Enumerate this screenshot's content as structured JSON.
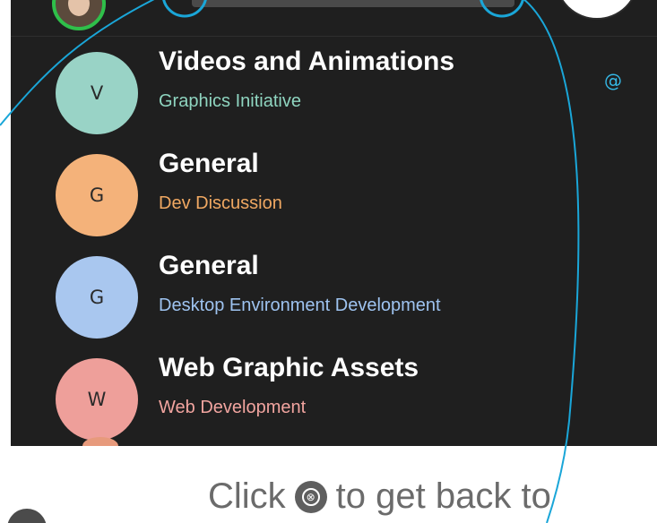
{
  "colors": {
    "app_background": "#1f1f1f",
    "callout_line": "#1aa6d8",
    "presence_ring": "#2fbf4a",
    "mention": "#35b8e6"
  },
  "spaces": [
    {
      "initial": "V",
      "title": "Videos and Animations",
      "team": "Graphics Initiative",
      "avatar_color": "#99d3c6",
      "team_color": "#8fd5c0",
      "mention_icon": "@"
    },
    {
      "initial": "G",
      "title": "General",
      "team": "Dev Discussion",
      "avatar_color": "#f4b27a",
      "team_color": "#f0a862"
    },
    {
      "initial": "G",
      "title": "General",
      "team": "Desktop Environment Development",
      "avatar_color": "#a9c7ef",
      "team_color": "#9ec3f0"
    },
    {
      "initial": "W",
      "title": "Web Graphic Assets",
      "team": "Web Development",
      "avatar_color": "#ee9f9a",
      "team_color": "#f1a49f"
    }
  ],
  "instruction": {
    "before": "Click",
    "close_glyph": "⊗",
    "after": "to get back to"
  }
}
